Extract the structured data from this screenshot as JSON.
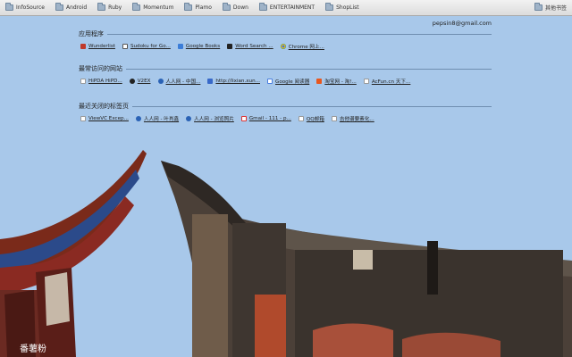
{
  "bookmarks_bar": {
    "items": [
      {
        "label": "InfoSource"
      },
      {
        "label": "Android"
      },
      {
        "label": "Ruby"
      },
      {
        "label": "Momentum"
      },
      {
        "label": "Plamo"
      },
      {
        "label": "Down"
      },
      {
        "label": "ENTERTAINMENT"
      },
      {
        "label": "ShopList"
      }
    ],
    "other_label": "其他书签"
  },
  "account": {
    "email": "pepsin8@gmail.com"
  },
  "apps_section": {
    "title": "应用程序",
    "items": [
      {
        "label": "Wunderlist",
        "icon": "wunderlist-icon"
      },
      {
        "label": "Sudoku for Go...",
        "icon": "sudoku-icon"
      },
      {
        "label": "Google Books",
        "icon": "google-books-icon"
      },
      {
        "label": "Word Search ...",
        "icon": "word-search-icon"
      },
      {
        "label": "Chrome 网上...",
        "icon": "chrome-icon"
      }
    ]
  },
  "most_visited_section": {
    "title": "最常访问的网站",
    "items": [
      {
        "label": "HiPDA HiPD...",
        "icon": "page-icon"
      },
      {
        "label": "V2EX",
        "icon": "v2ex-icon"
      },
      {
        "label": "人人网 - 中国...",
        "icon": "renren-icon"
      },
      {
        "label": "http://lixian.xun...",
        "icon": "xunlei-icon"
      },
      {
        "label": "Google 阅读器",
        "icon": "google-reader-icon"
      },
      {
        "label": "淘宝网 - 淘!...",
        "icon": "taobao-icon"
      },
      {
        "label": "AcFun.cn 天下...",
        "icon": "page-icon"
      }
    ]
  },
  "recently_closed_section": {
    "title": "最近关闭的标签页",
    "items": [
      {
        "label": "ViewVC Excep...",
        "icon": "page-icon"
      },
      {
        "label": "人人网 - 叶肖鑫",
        "icon": "renren-icon"
      },
      {
        "label": "人人网 - 浏览照片",
        "icon": "renren-icon"
      },
      {
        "label": "Gmail - 111 - p...",
        "icon": "gmail-icon"
      },
      {
        "label": "QQ邮箱",
        "icon": "page-icon"
      },
      {
        "label": "吉他谱要素化...",
        "icon": "page-icon"
      }
    ]
  },
  "watermark": "番薯粉",
  "colors": {
    "sky": "#a8c8ea",
    "link_text": "#222222"
  }
}
